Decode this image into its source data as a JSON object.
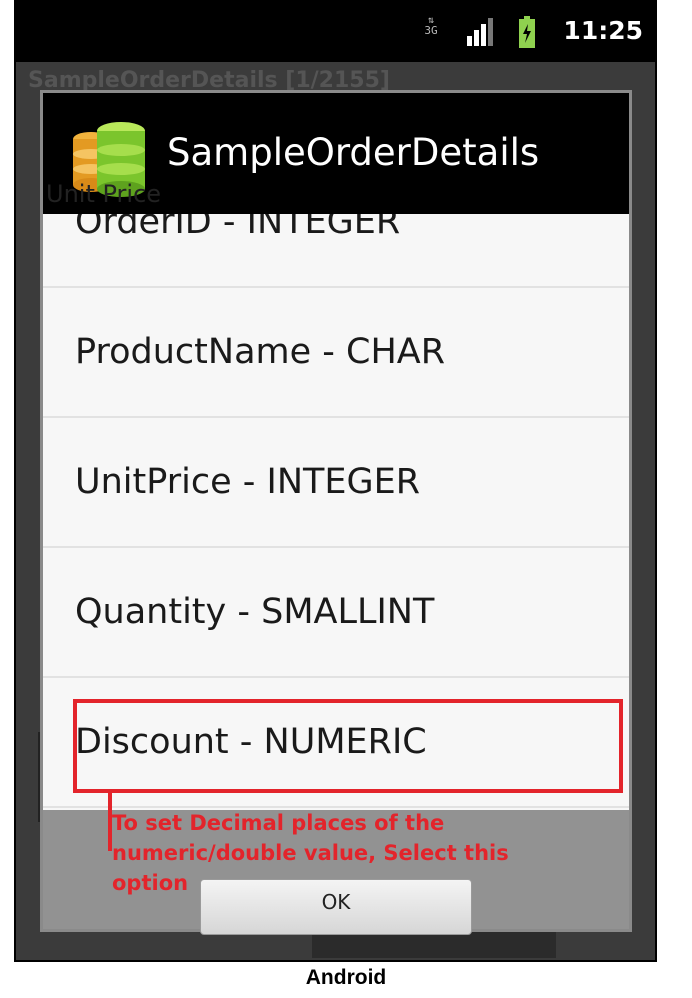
{
  "status_bar": {
    "time": "11:25",
    "network_label": "3G",
    "icons": [
      "network-3g-icon",
      "signal-icon",
      "battery-icon"
    ]
  },
  "background": {
    "title": "SampleOrderDetails [1/2155]",
    "field_label": "Unit Price"
  },
  "dialog": {
    "title": "SampleOrderDetails",
    "app_icon": "database-icon",
    "items": [
      {
        "label": "OrderID - INTEGER"
      },
      {
        "label": "ProductName - CHAR"
      },
      {
        "label": "UnitPrice - INTEGER"
      },
      {
        "label": "Quantity - SMALLINT"
      },
      {
        "label": "Discount - NUMERIC"
      }
    ],
    "ok_label": "OK"
  },
  "annotation": {
    "text": "To set Decimal places of the numeric/double value, Select this option",
    "color": "#e3242b"
  },
  "caption": "Android"
}
